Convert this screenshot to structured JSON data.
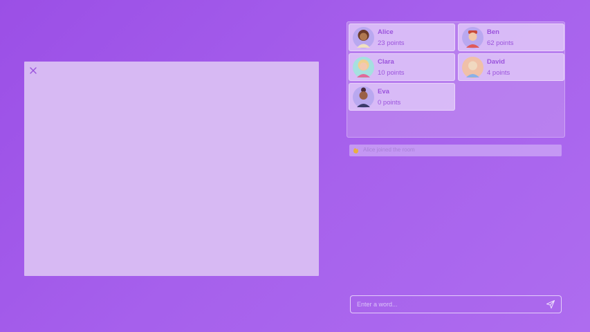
{
  "players": [
    {
      "name": "Alice",
      "points": "23 points",
      "avatar": "woman-curly-avatar"
    },
    {
      "name": "Ben",
      "points": "62 points",
      "avatar": "man-red-hair-avatar"
    },
    {
      "name": "Clara",
      "points": "10 points",
      "avatar": "woman-blonde-avatar"
    },
    {
      "name": "David",
      "points": "4 points",
      "avatar": "man-bald-avatar"
    },
    {
      "name": "Eva",
      "points": "0 points",
      "avatar": "woman-bun-avatar"
    }
  ],
  "log": {
    "message": "Alice joined the room",
    "icon": "waving-hand-icon"
  },
  "chat": {
    "placeholder": "Enter a word..."
  },
  "colors": {
    "background": "#a35ae9",
    "canvas": "#d7b9f3",
    "accent": "#9a52dc"
  }
}
